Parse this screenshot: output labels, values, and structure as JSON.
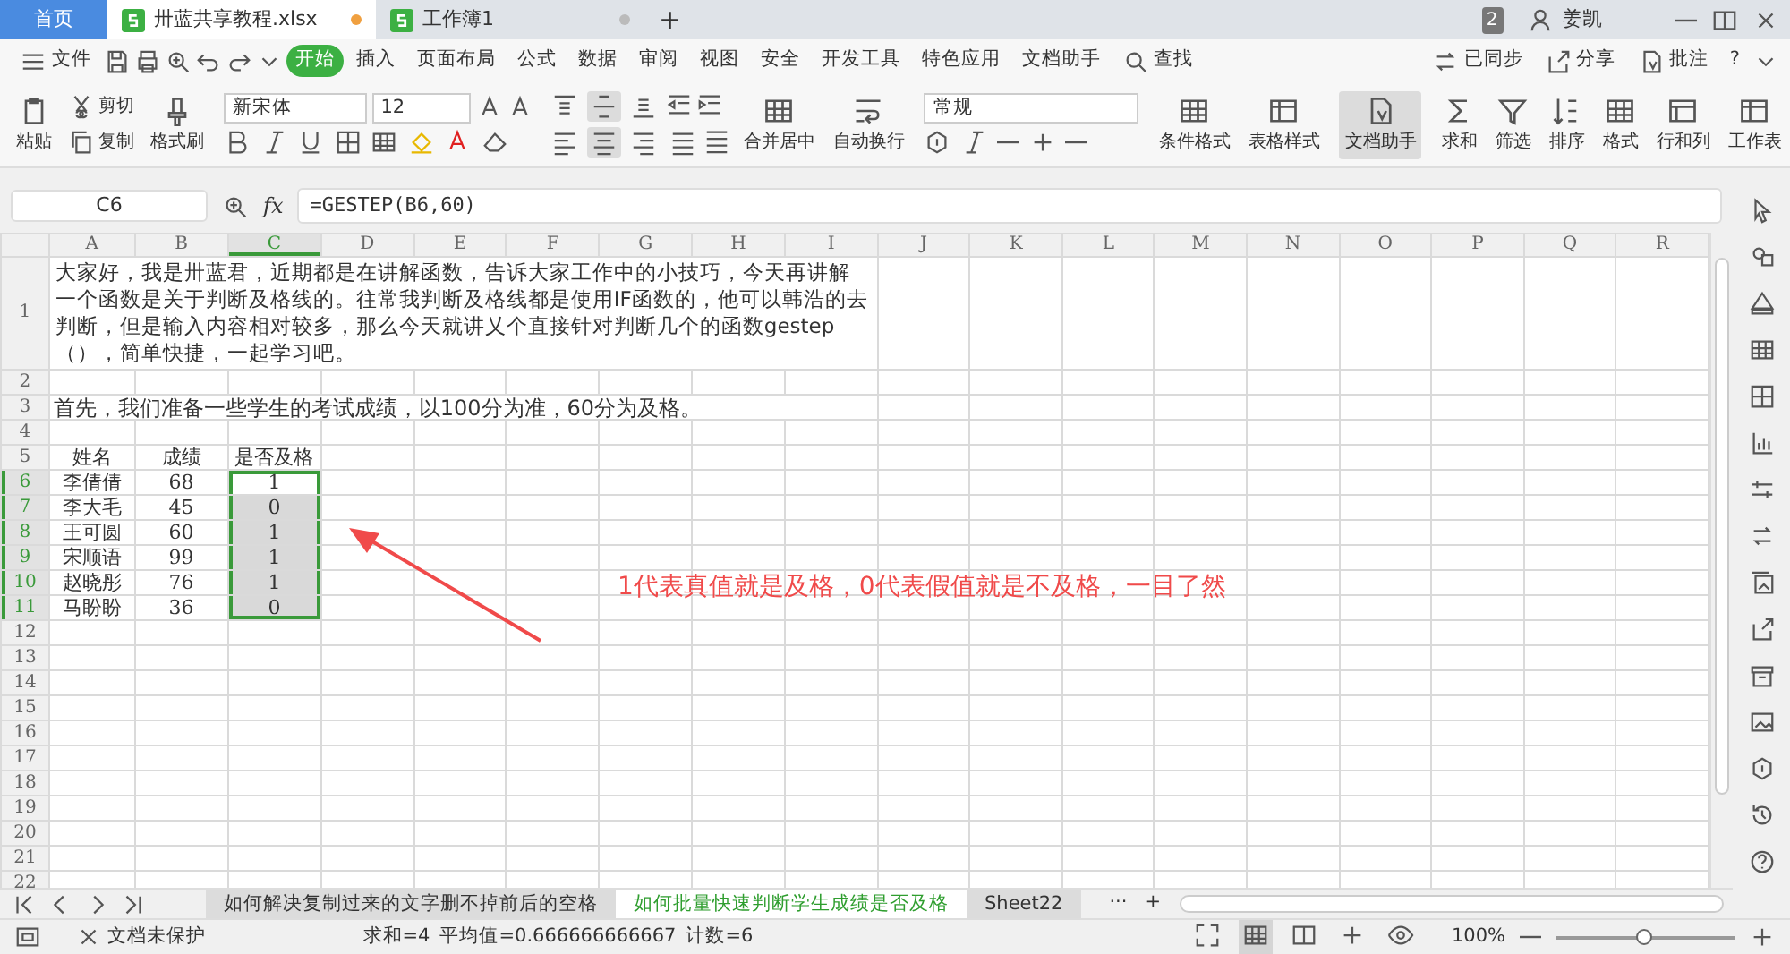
{
  "tabs": [
    {
      "label": "首页",
      "kind": "home",
      "selected": false
    },
    {
      "label": "卅蓝共享教程.xlsx",
      "kind": "file",
      "selected": true,
      "unsaved": true
    },
    {
      "label": "工作簿1",
      "kind": "file",
      "selected": false,
      "unsaved": false
    }
  ],
  "new_tab": "+",
  "title_right": {
    "window_count": "2",
    "user": "姜凯"
  },
  "menu": {
    "file": "文件",
    "items": [
      {
        "label": "开始",
        "selected": true
      },
      {
        "label": "插入",
        "selected": false
      },
      {
        "label": "页面布局",
        "selected": false
      },
      {
        "label": "公式",
        "selected": false
      },
      {
        "label": "数据",
        "selected": false
      },
      {
        "label": "审阅",
        "selected": false
      },
      {
        "label": "视图",
        "selected": false
      },
      {
        "label": "安全",
        "selected": false
      },
      {
        "label": "开发工具",
        "selected": false
      },
      {
        "label": "特色应用",
        "selected": false
      },
      {
        "label": "文档助手",
        "selected": false
      }
    ],
    "search": "查找",
    "sync": "已同步",
    "share": "分享",
    "comment": "批注",
    "help": "?"
  },
  "ribbon": {
    "paste": "粘贴",
    "cut": "剪切",
    "copy": "复制",
    "format_painter": "格式刷",
    "font": "新宋体",
    "font_size": "12",
    "align_top": [
      {
        "selected": false
      },
      {
        "selected": true
      },
      {
        "selected": false
      }
    ],
    "align_bottom": [
      {
        "selected": false
      },
      {
        "selected": true
      },
      {
        "selected": false
      },
      {
        "selected": false
      }
    ],
    "merge": "合并居中",
    "wrap": "自动换行",
    "number_format": "常规",
    "large_buttons": [
      {
        "label": "条件格式",
        "selected": false
      },
      {
        "label": "表格样式",
        "selected": false
      },
      {
        "label": "文档助手",
        "selected": true
      },
      {
        "label": "求和",
        "selected": false
      },
      {
        "label": "筛选",
        "selected": false
      },
      {
        "label": "排序",
        "selected": false
      },
      {
        "label": "格式",
        "selected": false
      },
      {
        "label": "行和列",
        "selected": false
      },
      {
        "label": "工作表",
        "selected": false
      }
    ]
  },
  "formula_bar": {
    "name_box": "C6",
    "fx": "fx",
    "formula": "=GESTEP(B6,60)"
  },
  "sheet": {
    "columns": [
      {
        "label": "A",
        "selected": false
      },
      {
        "label": "B",
        "selected": false
      },
      {
        "label": "C",
        "selected": true
      },
      {
        "label": "D",
        "selected": false
      },
      {
        "label": "E",
        "selected": false
      },
      {
        "label": "F",
        "selected": false
      },
      {
        "label": "G",
        "selected": false
      },
      {
        "label": "H",
        "selected": false
      },
      {
        "label": "I",
        "selected": false
      },
      {
        "label": "J",
        "selected": false
      },
      {
        "label": "K",
        "selected": false
      },
      {
        "label": "L",
        "selected": false
      },
      {
        "label": "M",
        "selected": false
      },
      {
        "label": "N",
        "selected": false
      },
      {
        "label": "O",
        "selected": false
      },
      {
        "label": "P",
        "selected": false
      },
      {
        "label": "Q",
        "selected": false
      },
      {
        "label": "R",
        "selected": false
      }
    ],
    "rows": [
      {
        "label": "1",
        "kind": "note",
        "selected": false,
        "text": "大家好，我是卅蓝君，近期都是在讲解函数，告诉大家工作中的小技巧，今天再讲解一个函数是关于判断及格线的。往常我判断及格线都是使用IF函数的，他可以韩浩的去判断，但是输入内容相对较多，那么今天就讲乂个直接针对判断几个的函数gestep（），简单快捷，一起学习吧。"
      },
      {
        "label": "2",
        "kind": "empty",
        "selected": false
      },
      {
        "label": "3",
        "kind": "line",
        "selected": false,
        "text": "首先，我们准备一些学生的考试成绩，以100分为准，60分为及格。"
      },
      {
        "label": "4",
        "kind": "empty",
        "selected": false
      },
      {
        "label": "5",
        "kind": "data",
        "selected": false,
        "cells": [
          {
            "text": "姓名",
            "selected": false
          },
          {
            "text": "成绩",
            "selected": false
          },
          {
            "text": "是否及格",
            "selected": false
          }
        ]
      },
      {
        "label": "6",
        "kind": "data",
        "selected": true,
        "cells": [
          {
            "text": "李倩倩",
            "selected": false
          },
          {
            "text": "68",
            "selected": false
          },
          {
            "text": "1",
            "selected": true,
            "active": true
          }
        ]
      },
      {
        "label": "7",
        "kind": "data",
        "selected": true,
        "cells": [
          {
            "text": "李大毛",
            "selected": false
          },
          {
            "text": "45",
            "selected": false
          },
          {
            "text": "0",
            "selected": true,
            "active": false
          }
        ]
      },
      {
        "label": "8",
        "kind": "data",
        "selected": true,
        "cells": [
          {
            "text": "王可圆",
            "selected": false
          },
          {
            "text": "60",
            "selected": false
          },
          {
            "text": "1",
            "selected": true,
            "active": false
          }
        ]
      },
      {
        "label": "9",
        "kind": "data",
        "selected": true,
        "cells": [
          {
            "text": "宋顺语",
            "selected": false
          },
          {
            "text": "99",
            "selected": false
          },
          {
            "text": "1",
            "selected": true,
            "active": false
          }
        ]
      },
      {
        "label": "10",
        "kind": "data",
        "selected": true,
        "cells": [
          {
            "text": "赵晓彤",
            "selected": false
          },
          {
            "text": "76",
            "selected": false
          },
          {
            "text": "1",
            "selected": true,
            "active": false
          }
        ]
      },
      {
        "label": "11",
        "kind": "data",
        "selected": true,
        "cells": [
          {
            "text": "马盼盼",
            "selected": false
          },
          {
            "text": "36",
            "selected": false
          },
          {
            "text": "0",
            "selected": true,
            "active": false
          }
        ]
      },
      {
        "label": "12",
        "kind": "empty",
        "selected": false
      },
      {
        "label": "13",
        "kind": "empty",
        "selected": false
      },
      {
        "label": "14",
        "kind": "empty",
        "selected": false
      },
      {
        "label": "15",
        "kind": "empty",
        "selected": false
      },
      {
        "label": "16",
        "kind": "empty",
        "selected": false
      },
      {
        "label": "17",
        "kind": "empty",
        "selected": false
      },
      {
        "label": "18",
        "kind": "empty",
        "selected": false
      },
      {
        "label": "19",
        "kind": "empty",
        "selected": false
      },
      {
        "label": "20",
        "kind": "empty",
        "selected": false
      },
      {
        "label": "21",
        "kind": "empty",
        "selected": false
      },
      {
        "label": "22",
        "kind": "empty",
        "selected": false
      }
    ]
  },
  "annotation": {
    "text": "1代表真值就是及格，0代表假值就是不及格，一目了然"
  },
  "sheet_tabs": {
    "tabs": [
      {
        "label": "如何解决复制过来的文字删不掉前后的空格",
        "selected": false
      },
      {
        "label": "如何批量快速判断学生成绩是否及格",
        "selected": true
      },
      {
        "label": "Sheet22",
        "selected": false
      }
    ],
    "more": "···",
    "add": "+"
  },
  "status_bar": {
    "protection": "文档未保护",
    "sum": "求和=4",
    "average": "平均值=0.666666666667",
    "count": "计数=6",
    "zoom": "100%",
    "zoom_slider": {
      "level": 0.5
    }
  }
}
